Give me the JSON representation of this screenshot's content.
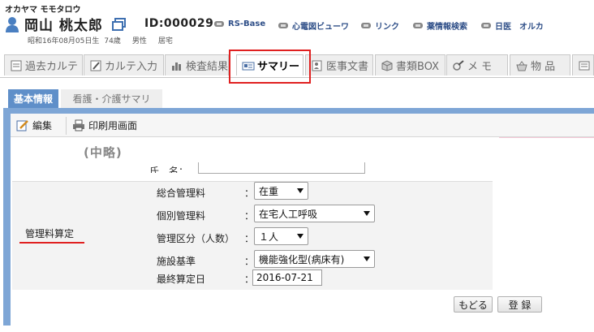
{
  "patient": {
    "kana": "オカヤマ モモタロウ",
    "name": "岡山 桃太郎",
    "id": "ID:000029",
    "birth": "昭和16年08月05日生",
    "age": "74歳",
    "sex": "男性",
    "residence": "居宅"
  },
  "header_links": [
    "RS-Base",
    "心電図ビューワ",
    "リンク",
    "薬情報検索",
    "日医",
    "オルカ"
  ],
  "tabs": [
    "過去カルテ",
    "カルテ入力",
    "検査結果",
    "サマリー",
    "医事文書",
    "書類BOX",
    "メ モ",
    "物 品"
  ],
  "active_tab": "サマリー",
  "subtabs": [
    "基本情報",
    "看護・介護サマリ"
  ],
  "toolbar": {
    "edit_label": "編集",
    "print_label": "印刷用画面"
  },
  "omitted_note": "(中略)",
  "cut_off_label": "氏　名：",
  "section": {
    "label": "管理料算定",
    "underline_color": "#e02020"
  },
  "form": {
    "general_fee": {
      "label": "総合管理料",
      "value": "在重"
    },
    "individual_fee": {
      "label": "個別管理料",
      "value": "在宅人工呼吸"
    },
    "category": {
      "label": "管理区分（人数）",
      "value": "１人"
    },
    "facility": {
      "label": "施設基準",
      "value": "機能強化型(病床有)"
    },
    "last_date": {
      "label": "最終算定日",
      "value": "2016-07-21"
    }
  },
  "colon": "：",
  "buttons": {
    "back": "もどる",
    "register": "登 録"
  },
  "colors": {
    "accent_blue": "#5f8fc9",
    "panel_border": "#7ea6d6",
    "highlight_red": "#e02020"
  }
}
